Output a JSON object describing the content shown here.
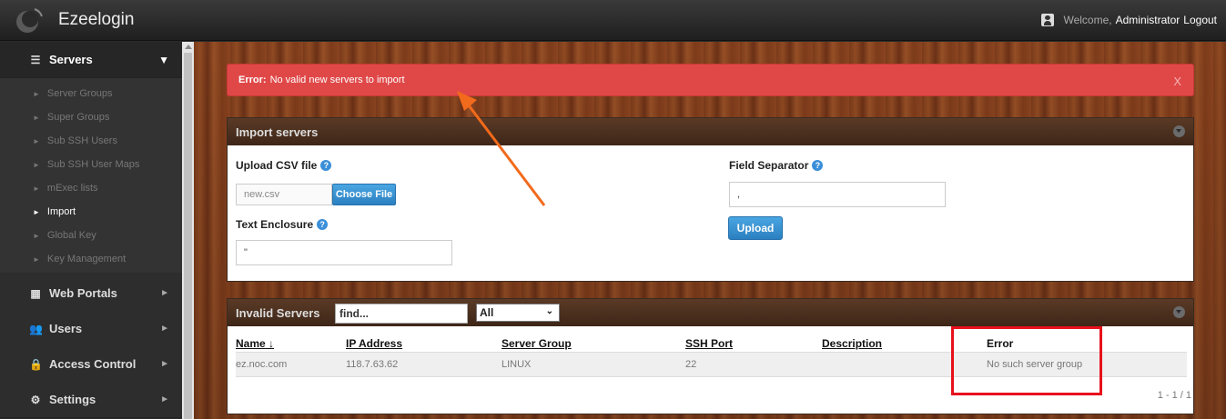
{
  "header": {
    "brand": "Ezeelogin",
    "welcome_text": "Welcome,",
    "user_name": "Administrator",
    "logout_label": "Logout"
  },
  "sidebar": {
    "servers_label": "Servers",
    "sub_items": [
      {
        "label": "Server Groups"
      },
      {
        "label": "Super Groups"
      },
      {
        "label": "Sub SSH Users"
      },
      {
        "label": "Sub SSH User Maps"
      },
      {
        "label": "mExec lists"
      },
      {
        "label": "Import"
      },
      {
        "label": "Global Key"
      },
      {
        "label": "Key Management"
      }
    ],
    "current_item": "Import",
    "sections": [
      {
        "label": "Web Portals"
      },
      {
        "label": "Users"
      },
      {
        "label": "Access Control"
      },
      {
        "label": "Settings"
      }
    ]
  },
  "alert": {
    "prefix": "Error:",
    "message": "No valid new servers to import",
    "close_label": "X",
    "color": "#e04848"
  },
  "import_panel": {
    "title": "Import servers",
    "upload_csv_label": "Upload CSV file",
    "file_name": "new.csv",
    "choose_file_label": "Choose File",
    "text_enclosure_label": "Text Enclosure",
    "text_enclosure_value": "\"",
    "field_separator_label": "Field Separator",
    "field_separator_value": ",",
    "upload_label": "Upload"
  },
  "invalid_panel": {
    "title": "Invalid Servers",
    "find_value": "find...",
    "filter_selected": "All",
    "columns": {
      "name": "Name",
      "ip": "IP Address",
      "group": "Server Group",
      "port": "SSH Port",
      "description": "Description",
      "error": "Error"
    },
    "sort_indicator": "↓",
    "rows": [
      {
        "name": "ez.noc.com",
        "ip": "118.7.63.62",
        "group": "LINUX",
        "port": "22",
        "description": "",
        "error": "No such server group"
      }
    ],
    "pagination": "1 - 1 / 1"
  },
  "colors": {
    "accent_blue": "#2b7fc0",
    "annotation_red": "#e8101b",
    "annotation_orange": "#f26a1b"
  }
}
